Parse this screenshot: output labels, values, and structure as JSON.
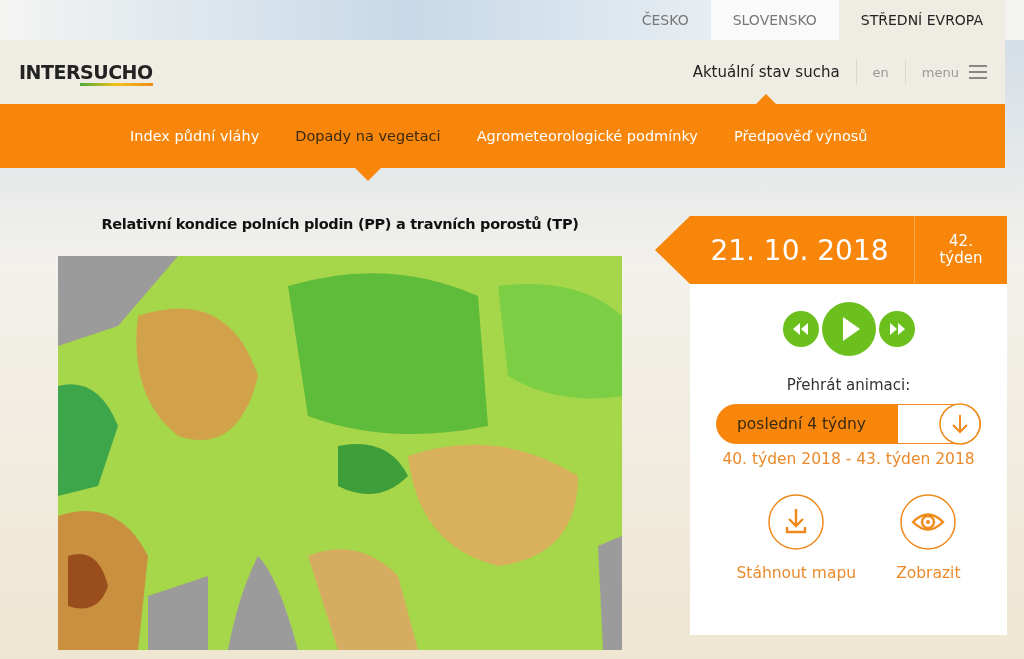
{
  "regions": [
    {
      "label": "ČESKO",
      "selected": false
    },
    {
      "label": "SLOVENSKO",
      "selected": false
    },
    {
      "label": "STŘEDNÍ EVROPA",
      "selected": true
    }
  ],
  "logo": {
    "part_1": "INTER",
    "part_2": "SUCHO"
  },
  "header_nav": [
    {
      "label": "Aktuální stav sucha",
      "kind": "link",
      "selected": true
    },
    {
      "label": "en",
      "kind": "link",
      "selected": false
    },
    {
      "label": "menu",
      "kind": "menu",
      "selected": false
    }
  ],
  "subnav": [
    {
      "label": "Index půdní vláhy",
      "selected": false
    },
    {
      "label": "Dopady na vegetaci",
      "selected": true
    },
    {
      "label": "Agrometeorologické podmínky",
      "selected": false
    },
    {
      "label": "Předpověď výnosů",
      "selected": false
    }
  ],
  "map": {
    "title": "Relativní kondice polních plodin (PP) a travních porostů (TP)",
    "kind": "picture"
  },
  "panel": {
    "date": "21. 10. 2018",
    "week_number": "42.",
    "week_label": "týden",
    "animation_label": "Přehrát animaci:",
    "animation_select": "poslední 4 týdny",
    "range": "40. týden 2018 - 43. týden 2018",
    "actions": [
      {
        "label": "Stáhnout mapu",
        "kind": "download"
      },
      {
        "label": "Zobrazit",
        "kind": "view"
      }
    ]
  }
}
